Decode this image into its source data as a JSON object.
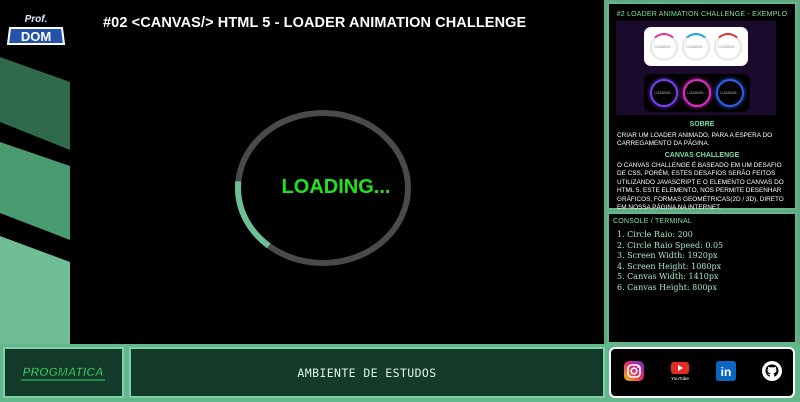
{
  "logo": {
    "prefix": "Prof.",
    "name": "DOM"
  },
  "header": {
    "title": "#02 <CANVAS/> HTML 5 - LOADER ANIMATION CHALLENGE"
  },
  "loader": {
    "text": "LOADING...",
    "progress_fraction": 0.28
  },
  "example_panel": {
    "title": "#2 LOADER ANIMATION CHALLENGE - EXEMPLO",
    "thumb_label": "LOADING...",
    "about_heading": "SOBRE",
    "about_text": "CRIAR UM LOADER ANIMADO, PARA A ESPERA DO CARREGAMENTO DA PÁGINA.",
    "canvas_heading": "CANVAS CHALLENGE",
    "canvas_text": "O CANVAS CHALLENGE É BASEADO EM UM DESAFIO DE CSS, PORÉM, ESTES DESAFIOS SERÃO FEITOS UTILIZANDO JAVASCRIPT E O ELEMENTO CANVAS DO HTML 5. ESTE ELEMENTO, NOS PERMITE DESENHAR GRÁFICOS, FORMAS GEOMÉTRICAS(2D / 3D), DIRETO EM NOSSA PÁGINA NA INTERNET."
  },
  "console": {
    "title": "CONSOLE / TERMINAL",
    "lines": [
      "1. Circle Raio: 200",
      "2. Circle Raio Speed: 0.05",
      "3. Screen Width: 1920px",
      "4. Screen Height: 1080px",
      "5. Canvas Width: 1410px",
      "6. Canvas Height: 800px"
    ]
  },
  "footer": {
    "brand": "PROGMATICA",
    "center_text": "AMBIENTE DE ESTUDOS",
    "youtube_label": "YouTube",
    "linkedin_label": "in"
  },
  "colors": {
    "accent_green": "#66b58c",
    "loading_green": "#1fe41f",
    "ring_gray": "#4a4a4a",
    "ring_progress": "#6dbf94"
  }
}
